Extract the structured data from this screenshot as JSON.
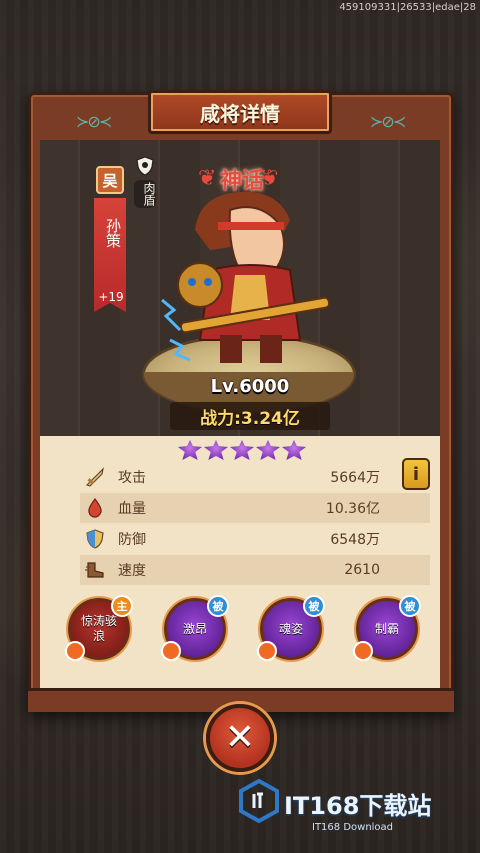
{
  "build_id": "459109331|26533|edae|28",
  "title": "咸将详情",
  "hero": {
    "faction": "吴",
    "name": "孙策",
    "plus_level": "+19",
    "role": "肉盾",
    "role_icon": "shield-icon",
    "rarity": "神话",
    "level_text": "Lv.6000",
    "power_text": "战力:3.24亿",
    "star_count": 5,
    "star_color": "#8a38c4"
  },
  "info_button": {
    "label": "i"
  },
  "stats": [
    {
      "icon": "sword-icon",
      "label": "攻击",
      "value": "5664万"
    },
    {
      "icon": "blood-drop-icon",
      "label": "血量",
      "value": "10.36亿"
    },
    {
      "icon": "shield-icon",
      "label": "防御",
      "value": "6548万"
    },
    {
      "icon": "boot-icon",
      "label": "速度",
      "value": "2610"
    }
  ],
  "skills": [
    {
      "name": "惊涛骇浪",
      "tag": "主",
      "type": "active"
    },
    {
      "name": "激昂",
      "tag": "被",
      "type": "passive"
    },
    {
      "name": "魂姿",
      "tag": "被",
      "type": "passive"
    },
    {
      "name": "制霸",
      "tag": "被",
      "type": "passive"
    }
  ],
  "close_button": {
    "icon": "close-icon",
    "label": "✕"
  },
  "watermark": {
    "main": "IT168下载站",
    "sub": "IT168 Download"
  },
  "colors": {
    "frame": "#7a3c24",
    "panel": "#f2e3c7",
    "rarity_red": "#e94a3b",
    "power_gold": "#ffd96b",
    "passive_purple": "#9a46d4",
    "active_red": "#b5322c"
  }
}
